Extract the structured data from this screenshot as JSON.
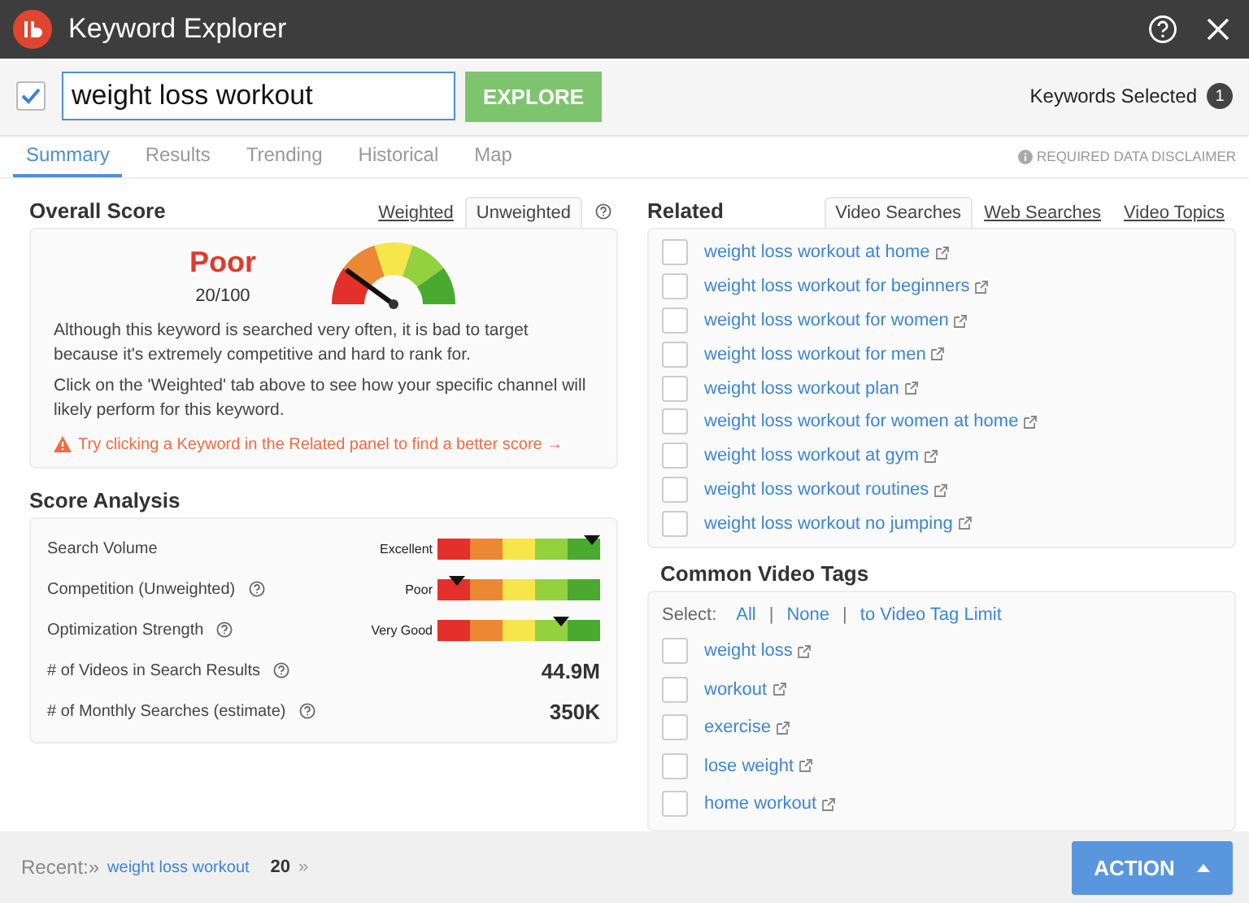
{
  "window": {
    "title": "Keyword Explorer"
  },
  "search": {
    "checked": true,
    "value": "weight loss workout",
    "button": "EXPLORE",
    "selected_label": "Keywords Selected",
    "selected_count": "1"
  },
  "tabs": [
    {
      "label": "Summary",
      "selected": true
    },
    {
      "label": "Results",
      "selected": false
    },
    {
      "label": "Trending",
      "selected": false
    },
    {
      "label": "Historical",
      "selected": false
    },
    {
      "label": "Map",
      "selected": false
    }
  ],
  "disclaimer": "REQUIRED DATA DISCLAIMER",
  "overall_score": {
    "title": "Overall Score",
    "tabs": [
      {
        "label": "Weighted",
        "selected": false
      },
      {
        "label": "Unweighted",
        "selected": true
      }
    ],
    "rating": "Poor",
    "score": "20/100",
    "level": 0.2,
    "paragraphs": [
      "Although this keyword is searched very often, it is bad to target because it's extremely competitive and hard to rank for.",
      "Click on the 'Weighted' tab above to see how your specific channel will likely perform for this keyword."
    ],
    "warning": "Try clicking a Keyword in the Related panel to find a better score →"
  },
  "score_analysis": {
    "title": "Score Analysis",
    "rows": [
      {
        "kind": "meter",
        "label": "Search Volume",
        "help": false,
        "reading": "Excellent",
        "level": 1.0
      },
      {
        "kind": "meter",
        "label": "Competition (Unweighted)",
        "help": true,
        "reading": "Poor",
        "level": 0.12
      },
      {
        "kind": "meter",
        "label": "Optimization Strength",
        "help": true,
        "reading": "Very Good",
        "level": 0.76
      },
      {
        "kind": "value",
        "label": "# of Videos in Search Results",
        "help": true,
        "value": "44.9M"
      },
      {
        "kind": "value",
        "label": "# of Monthly Searches (estimate)",
        "help": true,
        "value": "350K"
      }
    ]
  },
  "related": {
    "title": "Related",
    "tabs": [
      {
        "label": "Video Searches",
        "selected": true
      },
      {
        "label": "Web Searches",
        "selected": false
      },
      {
        "label": "Video Topics",
        "selected": false
      }
    ],
    "items": [
      {
        "label": "weight loss workout at home",
        "checked": false
      },
      {
        "label": "weight loss workout for beginners",
        "checked": false
      },
      {
        "label": "weight loss workout for women",
        "checked": false
      },
      {
        "label": "weight loss workout for men",
        "checked": false
      },
      {
        "label": "weight loss workout plan",
        "checked": false
      },
      {
        "label": "weight loss workout for women at home",
        "checked": false
      },
      {
        "label": "weight loss workout at gym",
        "checked": false
      },
      {
        "label": "weight loss workout routines",
        "checked": false
      },
      {
        "label": "weight loss workout no jumping",
        "checked": false
      }
    ]
  },
  "tags": {
    "title": "Common Video Tags",
    "select_label": "Select:",
    "select_links": [
      "All",
      "None",
      "to Video Tag Limit"
    ],
    "separator": "|",
    "items": [
      {
        "label": "weight loss",
        "checked": false
      },
      {
        "label": "workout",
        "checked": false
      },
      {
        "label": "exercise",
        "checked": false
      },
      {
        "label": "lose weight",
        "checked": false
      },
      {
        "label": "home workout",
        "checked": false
      }
    ]
  },
  "footer": {
    "recent_label": "Recent:»",
    "recent_link": "weight loss workout",
    "recent_count": "20",
    "recent_more": "»",
    "action": "ACTION"
  }
}
